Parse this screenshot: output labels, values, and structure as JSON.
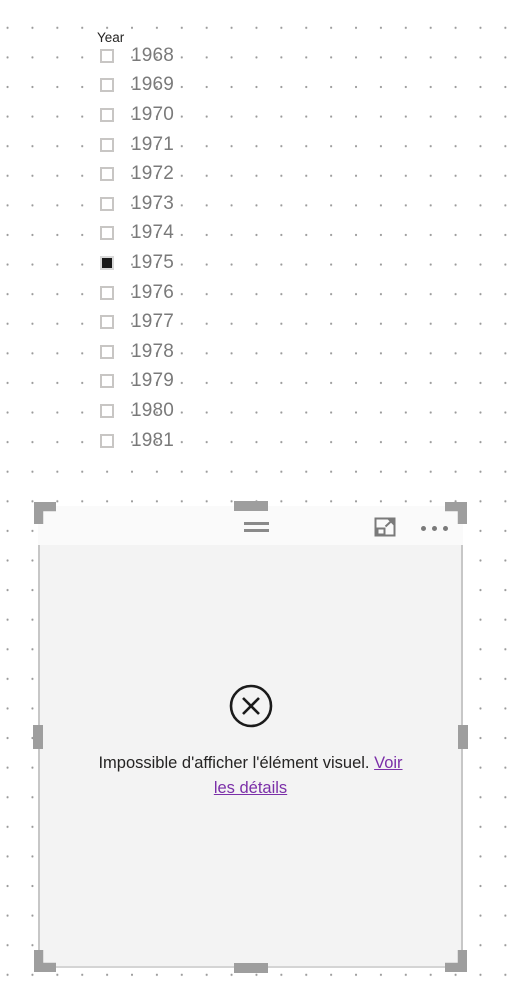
{
  "canvas": {
    "background_color": "#ffffff",
    "grid_dot_color": "#9a9a9a"
  },
  "slicer": {
    "title": "Year",
    "items": [
      {
        "label": "1968",
        "checked": false
      },
      {
        "label": "1969",
        "checked": false
      },
      {
        "label": "1970",
        "checked": false
      },
      {
        "label": "1971",
        "checked": false
      },
      {
        "label": "1972",
        "checked": false
      },
      {
        "label": "1973",
        "checked": false
      },
      {
        "label": "1974",
        "checked": false
      },
      {
        "label": "1975",
        "checked": true
      },
      {
        "label": "1976",
        "checked": false
      },
      {
        "label": "1977",
        "checked": false
      },
      {
        "label": "1978",
        "checked": false
      },
      {
        "label": "1979",
        "checked": false
      },
      {
        "label": "1980",
        "checked": false
      },
      {
        "label": "1981",
        "checked": false
      }
    ],
    "checked_fill_color": "#1a1a1a",
    "unchecked_border_color": "#c8c6c4",
    "label_color": "#7a7a7a"
  },
  "visual": {
    "header": {
      "filter_icon": "filter-icon",
      "focus_icon": "focus-mode-icon",
      "more_icon": "more-options-icon"
    },
    "error": {
      "icon": "error-circle-x-icon",
      "message": "Impossible d'afficher l'élément visuel. ",
      "link_label": "Voir les détails",
      "link_color": "#7b2fa8",
      "body_background": "#f3f3f3"
    },
    "selection": {
      "handle_color": "#9e9e9e",
      "selected": "true"
    }
  }
}
